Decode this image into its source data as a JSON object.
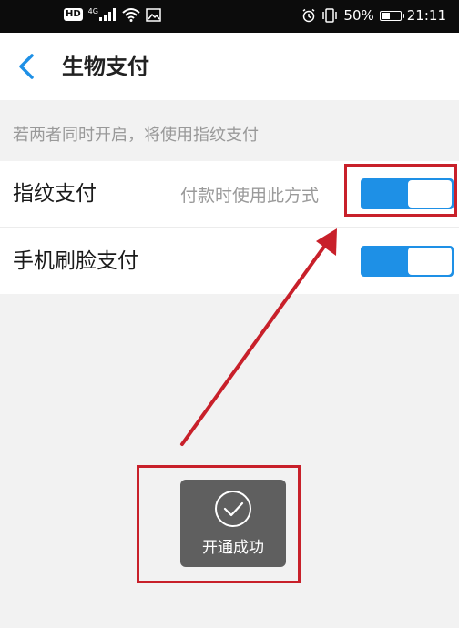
{
  "status_bar": {
    "network_badge": "HD",
    "network_type": "4G",
    "battery_percent": "50%",
    "time": "21:11",
    "battery_level": 0.5,
    "icons": [
      "hd-icon",
      "signal-icon",
      "wifi-icon",
      "image-notification-icon",
      "alarm-icon",
      "vibrate-icon",
      "battery-icon"
    ]
  },
  "header": {
    "title": "生物支付",
    "back_icon": "chevron-left-icon",
    "accent_color": "#1e90e6"
  },
  "hint": "若两者同时开启，将使用指纹支付",
  "settings": [
    {
      "label": "指纹支付",
      "description": "付款时使用此方式",
      "enabled": true
    },
    {
      "label": "手机刷脸支付",
      "description": "",
      "enabled": true
    }
  ],
  "toast": {
    "icon": "check-circle-icon",
    "text": "开通成功"
  },
  "annotation_color": "#c8202a"
}
